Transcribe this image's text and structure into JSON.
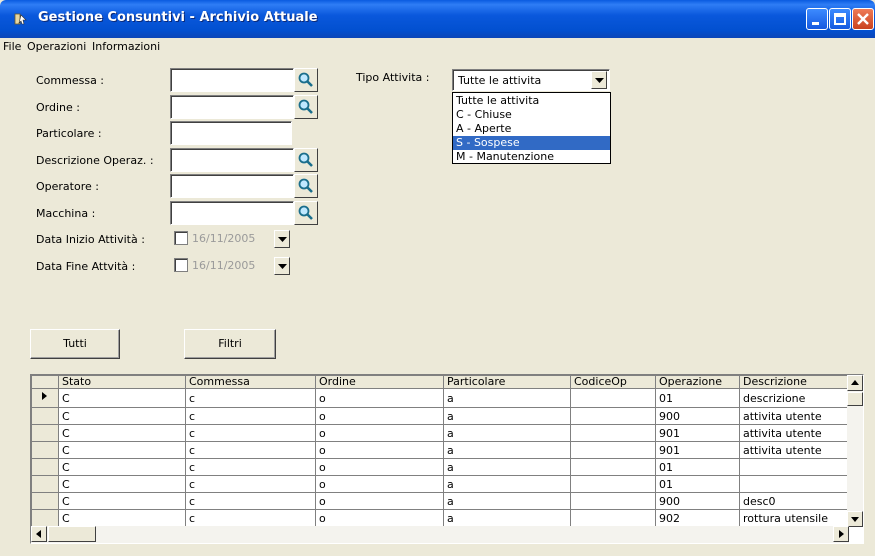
{
  "window": {
    "title": "Gestione Consuntivi - Archivio Attuale"
  },
  "menu": [
    "File",
    "Operazioni",
    "Informazioni"
  ],
  "filters": {
    "commessa_label": "Commessa :",
    "ordine_label": "Ordine :",
    "particolare_label": "Particolare :",
    "descrizione_label": "Descrizione Operaz. :",
    "operatore_label": "Operatore :",
    "macchina_label": "Macchina :",
    "data_inizio_label": "Data Inizio Attività :",
    "data_fine_label": "Data Fine Attvità :",
    "data_inizio_value": "16/11/2005",
    "data_fine_value": "16/11/2005",
    "commessa_value": "",
    "ordine_value": "",
    "particolare_value": "",
    "descrizione_value": "",
    "operatore_value": "",
    "macchina_value": ""
  },
  "tipo_attivita": {
    "label": "Tipo Attivita :",
    "selected": "Tutte le attivita",
    "options": [
      "Tutte le attivita",
      "C - Chiuse",
      "A - Aperte",
      "S - Sospese",
      "M - Manutenzione"
    ],
    "highlighted_index": 3
  },
  "buttons": {
    "tutti": "Tutti",
    "filtri": "Filtri"
  },
  "grid": {
    "columns": [
      "Stato",
      "Commessa",
      "Ordine",
      "Particolare",
      "CodiceOp",
      "Operazione",
      "Descrizione"
    ],
    "current_row_index": 0,
    "rows": [
      [
        "C",
        "c",
        "o",
        "a",
        "",
        "01",
        "descrizione"
      ],
      [
        "C",
        "c",
        "o",
        "a",
        "",
        "900",
        "attivita utente"
      ],
      [
        "C",
        "c",
        "o",
        "a",
        "",
        "901",
        "attivita utente"
      ],
      [
        "C",
        "c",
        "o",
        "a",
        "",
        "901",
        "attivita utente"
      ],
      [
        "C",
        "c",
        "o",
        "a",
        "",
        "01",
        ""
      ],
      [
        "C",
        "c",
        "o",
        "a",
        "",
        "01",
        ""
      ],
      [
        "C",
        "c",
        "o",
        "a",
        "",
        "900",
        "desc0"
      ],
      [
        "C",
        "c",
        "o",
        "a",
        "",
        "902",
        "rottura utensile"
      ]
    ]
  }
}
